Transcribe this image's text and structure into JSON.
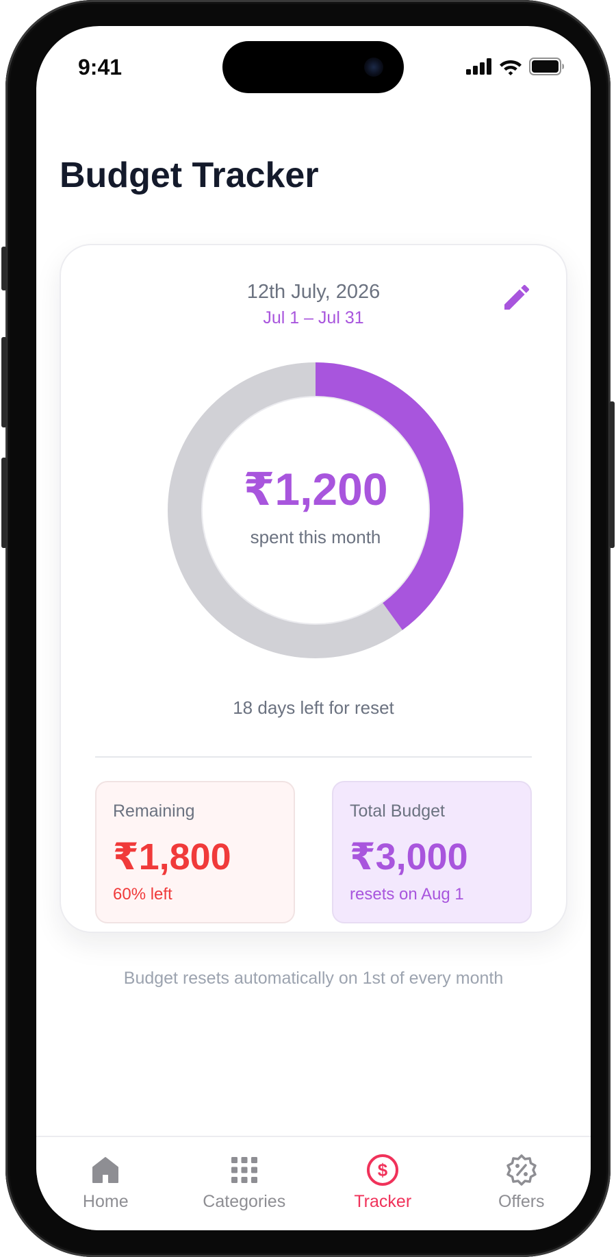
{
  "status_bar": {
    "time": "9:41"
  },
  "header": {
    "title": "Budget Tracker"
  },
  "card": {
    "date": "12th July, 2026",
    "period": "Jul 1 – Jul 31",
    "spent_amount": "₹1,200",
    "spent_label": "spent this month",
    "spent_fraction": 0.4,
    "days_left": "18 days left for reset",
    "remaining": {
      "label": "Remaining",
      "value": "₹1,800",
      "sub": "60% left"
    },
    "total_budget": {
      "label": "Total Budget",
      "value": "₹3,000",
      "sub": "resets on Aug 1"
    }
  },
  "footnote": "Budget resets automatically on 1st of every month",
  "tabs": [
    {
      "label": "Home",
      "icon": "home-icon",
      "active": false
    },
    {
      "label": "Categories",
      "icon": "grid-icon",
      "active": false
    },
    {
      "label": "Tracker",
      "icon": "dollar-circle-icon",
      "active": true
    },
    {
      "label": "Offers",
      "icon": "discount-badge-icon",
      "active": false
    }
  ],
  "colors": {
    "accent": "#a855dd",
    "track": "#d1d1d6",
    "danger": "#f03a3a",
    "tab_active": "#f0325a",
    "tab_inactive": "#8e8e93"
  }
}
